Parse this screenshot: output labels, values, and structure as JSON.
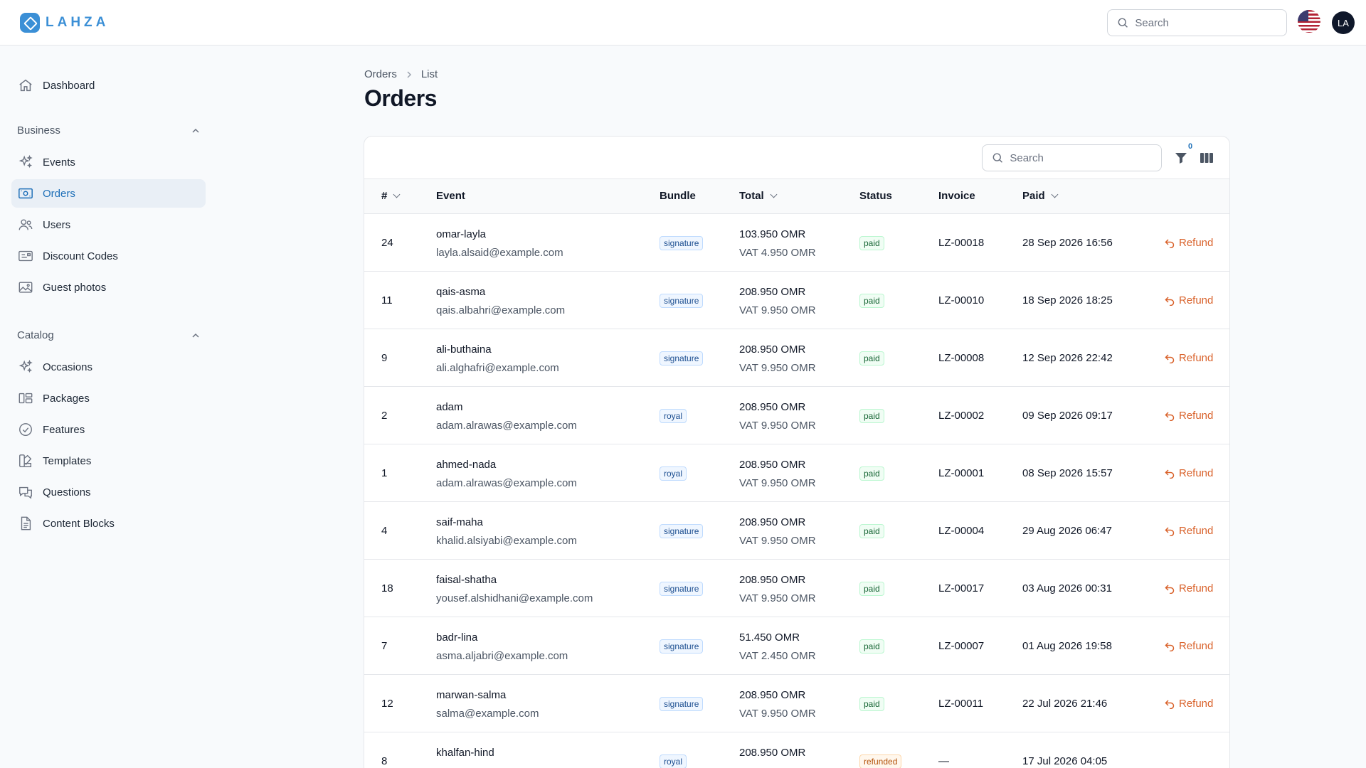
{
  "app": {
    "brand": "LAHZA"
  },
  "header": {
    "search_placeholder": "Search",
    "avatar_initials": "LA",
    "locale_icon": "us-flag-icon"
  },
  "sidebar": {
    "dashboard": "Dashboard",
    "business": {
      "label": "Business",
      "items": [
        "Events",
        "Orders",
        "Users",
        "Discount Codes",
        "Guest photos"
      ]
    },
    "catalog": {
      "label": "Catalog",
      "items": [
        "Occasions",
        "Packages",
        "Features",
        "Templates",
        "Questions",
        "Content Blocks"
      ]
    },
    "active_item": "Orders"
  },
  "breadcrumb": {
    "root": "Orders",
    "current": "List"
  },
  "page": {
    "title": "Orders"
  },
  "table": {
    "search_placeholder": "Search",
    "filter_count": "0",
    "columns": {
      "num": "#",
      "event": "Event",
      "bundle": "Bundle",
      "total": "Total",
      "status": "Status",
      "invoice": "Invoice",
      "paid": "Paid"
    },
    "action_label": "Refund",
    "rows": [
      {
        "num": "24",
        "event": "omar-layla",
        "email": "layla.alsaid@example.com",
        "bundle": "signature",
        "total": "103.950 OMR",
        "vat": "VAT 4.950 OMR",
        "status": "paid",
        "invoice": "LZ-00018",
        "paid": "28 Sep 2026 16:56",
        "action": "Refund"
      },
      {
        "num": "11",
        "event": "qais-asma",
        "email": "qais.albahri@example.com",
        "bundle": "signature",
        "total": "208.950 OMR",
        "vat": "VAT 9.950 OMR",
        "status": "paid",
        "invoice": "LZ-00010",
        "paid": "18 Sep 2026 18:25",
        "action": "Refund"
      },
      {
        "num": "9",
        "event": "ali-buthaina",
        "email": "ali.alghafri@example.com",
        "bundle": "signature",
        "total": "208.950 OMR",
        "vat": "VAT 9.950 OMR",
        "status": "paid",
        "invoice": "LZ-00008",
        "paid": "12 Sep 2026 22:42",
        "action": "Refund"
      },
      {
        "num": "2",
        "event": "adam",
        "email": "adam.alrawas@example.com",
        "bundle": "royal",
        "total": "208.950 OMR",
        "vat": "VAT 9.950 OMR",
        "status": "paid",
        "invoice": "LZ-00002",
        "paid": "09 Sep 2026 09:17",
        "action": "Refund"
      },
      {
        "num": "1",
        "event": "ahmed-nada",
        "email": "adam.alrawas@example.com",
        "bundle": "royal",
        "total": "208.950 OMR",
        "vat": "VAT 9.950 OMR",
        "status": "paid",
        "invoice": "LZ-00001",
        "paid": "08 Sep 2026 15:57",
        "action": "Refund"
      },
      {
        "num": "4",
        "event": "saif-maha",
        "email": "khalid.alsiyabi@example.com",
        "bundle": "signature",
        "total": "208.950 OMR",
        "vat": "VAT 9.950 OMR",
        "status": "paid",
        "invoice": "LZ-00004",
        "paid": "29 Aug 2026 06:47",
        "action": "Refund"
      },
      {
        "num": "18",
        "event": "faisal-shatha",
        "email": "yousef.alshidhani@example.com",
        "bundle": "signature",
        "total": "208.950 OMR",
        "vat": "VAT 9.950 OMR",
        "status": "paid",
        "invoice": "LZ-00017",
        "paid": "03 Aug 2026 00:31",
        "action": "Refund"
      },
      {
        "num": "7",
        "event": "badr-lina",
        "email": "asma.aljabri@example.com",
        "bundle": "signature",
        "total": "51.450 OMR",
        "vat": "VAT 2.450 OMR",
        "status": "paid",
        "invoice": "LZ-00007",
        "paid": "01 Aug 2026 19:58",
        "action": "Refund"
      },
      {
        "num": "12",
        "event": "marwan-salma",
        "email": "salma@example.com",
        "bundle": "signature",
        "total": "208.950 OMR",
        "vat": "VAT 9.950 OMR",
        "status": "paid",
        "invoice": "LZ-00011",
        "paid": "22 Jul 2026 21:46",
        "action": "Refund"
      },
      {
        "num": "8",
        "event": "khalfan-hind",
        "email": "",
        "bundle": "royal",
        "total": "208.950 OMR",
        "vat": "",
        "status": "refunded",
        "invoice": "—",
        "paid": "17 Jul 2026 04:05",
        "action": ""
      }
    ]
  },
  "colors": {
    "accent": "#1d6fb8",
    "brand": "#3b8fd6",
    "refund": "#d9622b",
    "paid_badge": "#166534",
    "refunded_badge": "#b45309"
  }
}
